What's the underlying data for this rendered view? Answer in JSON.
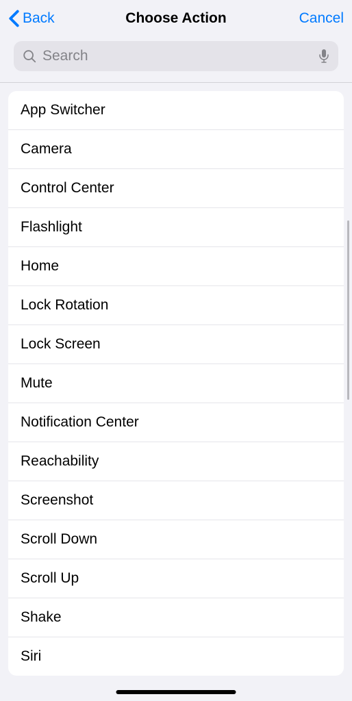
{
  "nav": {
    "back_label": "Back",
    "title": "Choose Action",
    "cancel_label": "Cancel"
  },
  "search": {
    "placeholder": "Search",
    "value": ""
  },
  "actions": [
    {
      "label": "App Switcher"
    },
    {
      "label": "Camera"
    },
    {
      "label": "Control Center"
    },
    {
      "label": "Flashlight"
    },
    {
      "label": "Home"
    },
    {
      "label": "Lock Rotation"
    },
    {
      "label": "Lock Screen"
    },
    {
      "label": "Mute"
    },
    {
      "label": "Notification Center"
    },
    {
      "label": "Reachability"
    },
    {
      "label": "Screenshot"
    },
    {
      "label": "Scroll Down"
    },
    {
      "label": "Scroll Up"
    },
    {
      "label": "Shake"
    },
    {
      "label": "Siri"
    }
  ]
}
